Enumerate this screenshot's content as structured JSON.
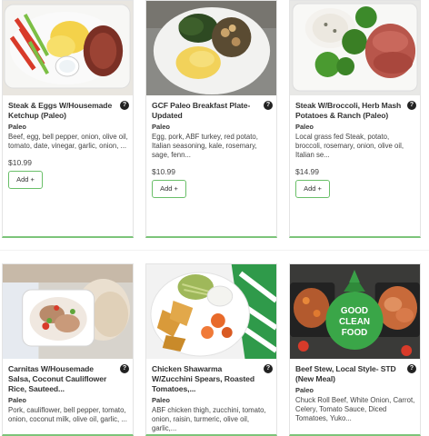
{
  "products": [
    {
      "title": "Steak & Eggs W/Housemade Ketchup (Paleo)",
      "tag": "Paleo",
      "ingredients": "Beef, egg, bell pepper, onion, olive oil, tomato, date, vinegar, garlic, onion, ...",
      "price": "$10.99",
      "add_label": "Add +",
      "info": "?"
    },
    {
      "title": "GCF Paleo Breakfast Plate-Updated",
      "tag": "Paleo",
      "ingredients": "Egg, pork, ABF turkey, red potato, Italian seasoning, kale, rosemary, sage, fenn...",
      "price": "$10.99",
      "add_label": "Add +",
      "info": "?"
    },
    {
      "title": "Steak W/Broccoli, Herb Mash Potatoes & Ranch (Paleo)",
      "tag": "Paleo",
      "ingredients": "Local grass fed Steak, potato, broccoli,  rosemary, onion, olive oil, Italian se...",
      "price": "$14.99",
      "add_label": "Add +",
      "info": "?"
    },
    {
      "title": "Carnitas W/Housemade Salsa, Coconut Cauliflower Rice, Sauteed...",
      "tag": "Paleo",
      "ingredients": "Pork, cauliflower, bell pepper, tomato, onion, coconut milk, olive oil, garlic, ...",
      "info": "?"
    },
    {
      "title": "Chicken Shawarma W/Zucchini Spears, Roasted Tomatoes,...",
      "tag": "Paleo",
      "ingredients": "ABF chicken thigh, zucchini, tomato, onion, raisin, turmeric, olive oil, garlic,...",
      "info": "?"
    },
    {
      "title": "Beef Stew, Local Style- STD (New Meal)",
      "tag": "Paleo",
      "ingredients": "Chuck Roll Beef, White Onion, Carrot, Celery, Tomato Sauce, Diced Tomatoes, Yuko...",
      "info": "?",
      "logo_text": [
        "GOOD",
        "CLEAN",
        "FOOD"
      ]
    }
  ],
  "colors": {
    "accent_green": "#6abf69",
    "card_border": "#e4e4e4"
  }
}
